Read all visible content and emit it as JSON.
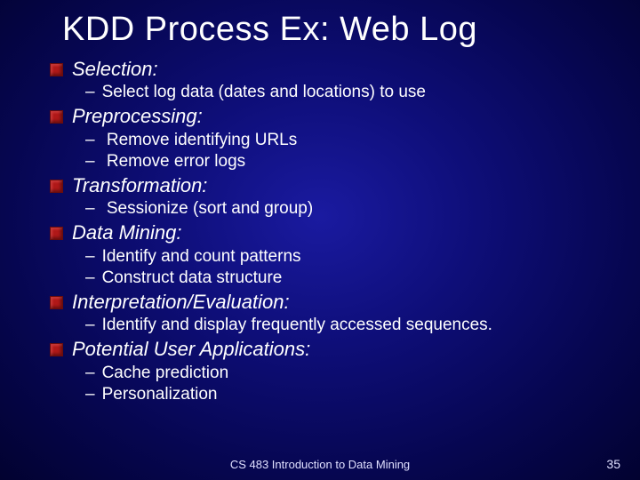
{
  "title": "KDD Process Ex:  Web Log",
  "sections": [
    {
      "heading": "Selection:",
      "items": [
        "Select log data (dates and locations) to use"
      ]
    },
    {
      "heading": "Preprocessing:",
      "items": [
        " Remove identifying URLs",
        " Remove error logs"
      ]
    },
    {
      "heading": "Transformation:",
      "items": [
        " Sessionize (sort and group)"
      ]
    },
    {
      "heading": "Data Mining:",
      "items": [
        "Identify and count patterns",
        "Construct data structure"
      ]
    },
    {
      "heading": "Interpretation/Evaluation:",
      "items": [
        "Identify and display frequently accessed sequences."
      ]
    },
    {
      "heading": "Potential User Applications:",
      "items": [
        "Cache prediction",
        "Personalization"
      ]
    }
  ],
  "footer": {
    "course": "CS 483 Introduction to Data Mining",
    "page": "35"
  }
}
